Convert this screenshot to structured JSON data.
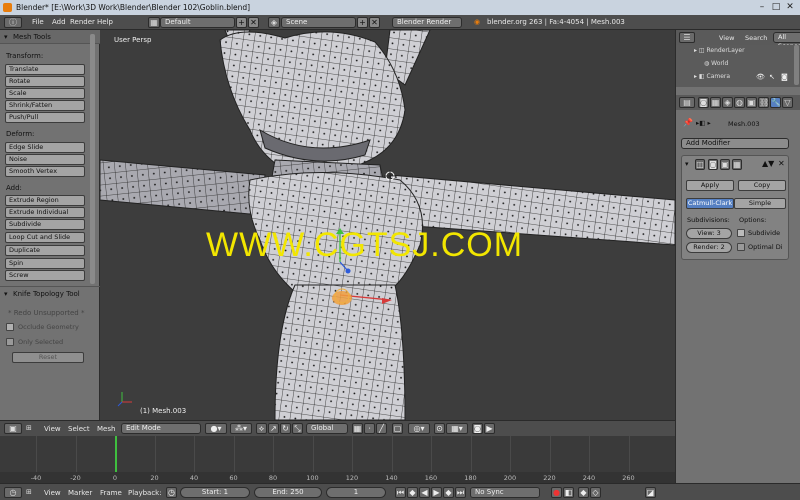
{
  "window": {
    "title": "Blender* [E:\\Work\\3D Work\\Blender\\Blender 102\\Goblin.blend]"
  },
  "infobar": {
    "menus": [
      "File",
      "Add",
      "Render",
      "Help"
    ],
    "layout": "Default",
    "scene": "Scene",
    "engine": "Blender Render",
    "stats": "blender.org 263 | Fa:4-4054 | Mesh.003"
  },
  "toolshelf": {
    "header": "Mesh Tools",
    "transform_label": "Transform:",
    "transform": [
      "Translate",
      "Rotate",
      "Scale",
      "Shrink/Fatten",
      "Push/Pull"
    ],
    "deform_label": "Deform:",
    "deform": [
      "Edge Slide",
      "Noise",
      "Smooth Vertex"
    ],
    "add_label": "Add:",
    "add": [
      "Extrude Region",
      "Extrude Individual",
      "Subdivide",
      "Loop Cut and Slide",
      "Duplicate",
      "Spin",
      "Screw"
    ],
    "operator_header": "Knife Topology Tool",
    "redo": "* Redo Unsupported *",
    "occlude": "Occlude Geometry",
    "only_selected": "Only Selected",
    "reset": "Reset"
  },
  "viewport": {
    "view_label": "User Persp",
    "object_label": "(1) Mesh.003",
    "watermark": "WWW.CGTSJ.COM"
  },
  "outliner": {
    "view": "View",
    "search": "Search",
    "all_scenes": "All Scenes",
    "items": [
      "RenderLayer",
      "World",
      "Camera"
    ]
  },
  "properties": {
    "object": "Mesh.003",
    "add_modifier": "Add Modifier",
    "apply": "Apply",
    "copy": "Copy",
    "catmull": "Catmull-Clark",
    "simple": "Simple",
    "subdivisions_label": "Subdivisions:",
    "options_label": "Options:",
    "view_level": "View: 3",
    "render_level": "Render: 2",
    "subdivide_uvs": "Subdivide",
    "optimal": "Optimal Di"
  },
  "viewport_header": {
    "view": "View",
    "select": "Select",
    "mesh": "Mesh",
    "mode": "Edit Mode",
    "orientation": "Global"
  },
  "timeline": {
    "ticks": [
      "-40",
      "-20",
      "0",
      "20",
      "40",
      "60",
      "80",
      "100",
      "120",
      "140",
      "160",
      "180",
      "200",
      "220",
      "240",
      "260"
    ]
  },
  "timeline_header": {
    "view": "View",
    "marker": "Marker",
    "frame": "Frame",
    "playback": "Playback:",
    "start": "Start: 1",
    "end": "End: 250",
    "current": "1",
    "sync": "No Sync"
  },
  "colors": {
    "watermark": "#f2e600",
    "accent_blue": "#5680c2",
    "current_frame": "#3fbf3f"
  }
}
